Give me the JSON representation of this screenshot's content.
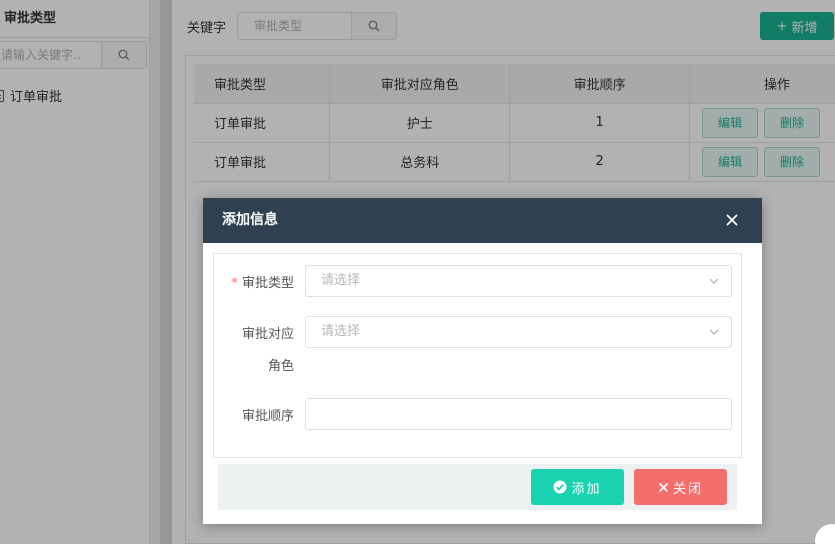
{
  "sidebar": {
    "title": "审批类型",
    "search_placeholder": "请输入关键字..",
    "tree_item": "订单审批"
  },
  "toolbar": {
    "keyword_label": "关键字",
    "keyword_placeholder": "审批类型",
    "add_label": "新增"
  },
  "table": {
    "headers": [
      "审批类型",
      "审批对应角色",
      "审批顺序",
      "操作"
    ],
    "rows": [
      {
        "type": "订单审批",
        "role": "护士",
        "order": "1",
        "edit": "编辑",
        "delete": "删除"
      },
      {
        "type": "订单审批",
        "role": "总务科",
        "order": "2",
        "edit": "编辑",
        "delete": "删除"
      }
    ]
  },
  "dialog": {
    "title": "添加信息",
    "fields": {
      "type_label": "审批类型",
      "type_placeholder": "请选择",
      "role_label_line1": "审批对应",
      "role_label_line2": "角色",
      "role_placeholder": "请选择",
      "order_label": "审批顺序",
      "order_value": ""
    },
    "confirm_label": "添加",
    "cancel_label": "关闭"
  },
  "colors": {
    "header_bg": "#2f4050",
    "accent": "#1ab394",
    "confirm": "#1ad1b0",
    "cancel": "#f46e6e",
    "required": "#f56c6c"
  }
}
